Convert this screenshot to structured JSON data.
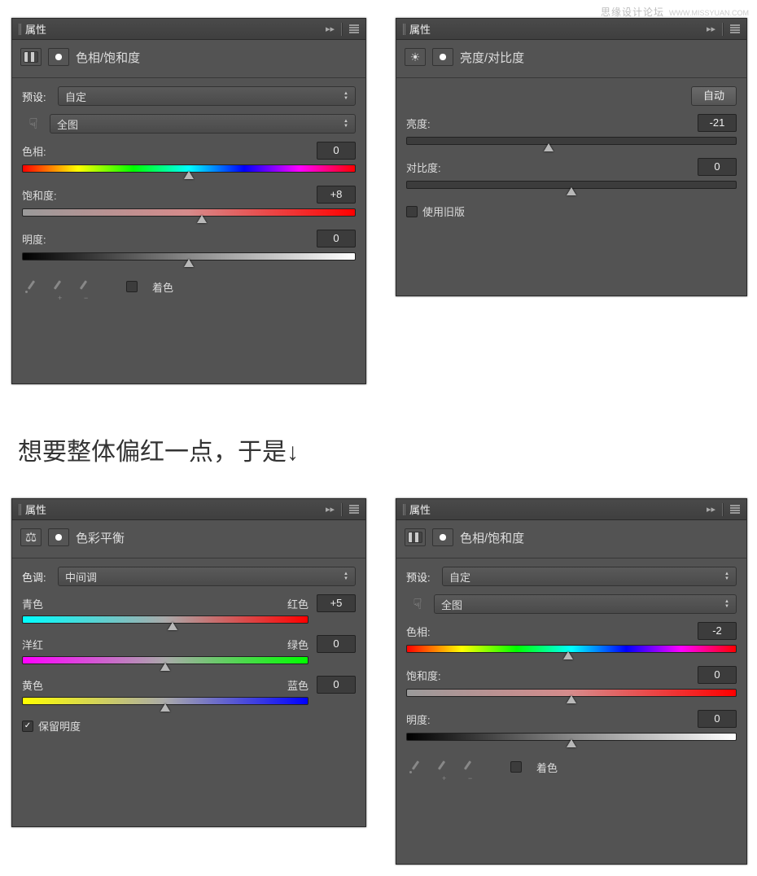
{
  "watermark": {
    "main": "思缘设计论坛",
    "sub": "WWW.MISSYUAN.COM"
  },
  "caption": "想要整体偏红一点，于是",
  "panels": {
    "hueSat1": {
      "title": "属性",
      "subtitle": "色相/饱和度",
      "presetLabel": "预设:",
      "presetValue": "自定",
      "rangeValue": "全图",
      "hue": {
        "label": "色相:",
        "value": "0"
      },
      "sat": {
        "label": "饱和度:",
        "value": "+8"
      },
      "light": {
        "label": "明度:",
        "value": "0"
      },
      "colorize": "着色"
    },
    "brightContrast": {
      "title": "属性",
      "subtitle": "亮度/对比度",
      "auto": "自动",
      "bright": {
        "label": "亮度:",
        "value": "-21"
      },
      "contrast": {
        "label": "对比度:",
        "value": "0"
      },
      "legacy": "使用旧版"
    },
    "colorBalance": {
      "title": "属性",
      "subtitle": "色彩平衡",
      "toneLabel": "色调:",
      "toneValue": "中间调",
      "cr": {
        "left": "青色",
        "right": "红色",
        "value": "+5"
      },
      "mg": {
        "left": "洋红",
        "right": "绿色",
        "value": "0"
      },
      "yb": {
        "left": "黄色",
        "right": "蓝色",
        "value": "0"
      },
      "preserve": "保留明度"
    },
    "hueSat2": {
      "title": "属性",
      "subtitle": "色相/饱和度",
      "presetLabel": "预设:",
      "presetValue": "自定",
      "rangeValue": "全图",
      "hue": {
        "label": "色相:",
        "value": "-2"
      },
      "sat": {
        "label": "饱和度:",
        "value": "0"
      },
      "light": {
        "label": "明度:",
        "value": "0"
      },
      "colorize": "着色"
    }
  }
}
